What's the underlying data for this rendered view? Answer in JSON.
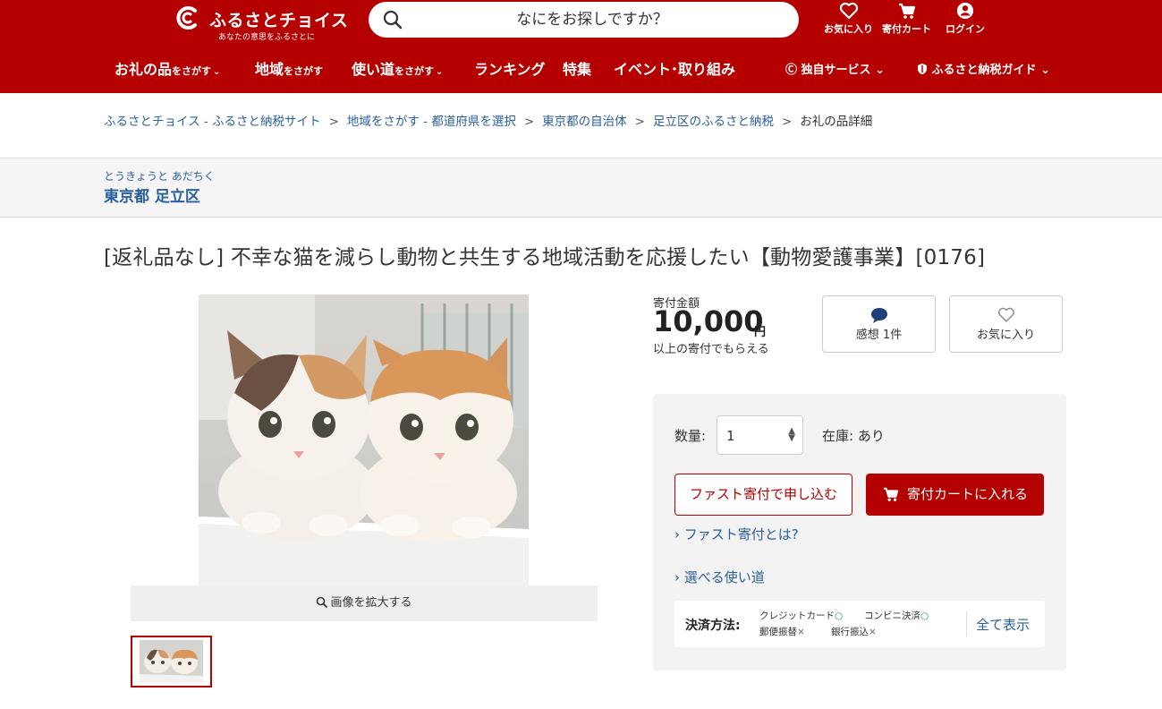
{
  "header": {
    "logo_text": "ふるさとチョイス",
    "logo_sub": "あなたの意思をふるさとに",
    "search_placeholder": "なにをお探しですか？",
    "favorites_label": "お気に入り",
    "cart_label": "寄付カート",
    "login_label": "ログイン",
    "brand_color": "#b50000"
  },
  "nav": {
    "gifts_main": "お礼の品",
    "gifts_small": "をさがす",
    "region_main": "地域",
    "region_small": "をさがす",
    "usage_main": "使い道",
    "usage_small": "をさがす",
    "ranking": "ランキング",
    "feature": "特集",
    "events": "イベント･取り組み",
    "services": "独自サービス",
    "guide": "ふるさと納税ガイド"
  },
  "breadcrumb": {
    "items": [
      "ふるさとチョイス - ふるさと納税サイト",
      "地域をさがす - 都道府県を選択",
      "東京都の自治体",
      "足立区のふるさと納税"
    ],
    "current": "お礼の品詳細",
    "separator": ">"
  },
  "municipality": {
    "ruby": "とうきょうと あだちく",
    "name": "東京都 足立区"
  },
  "product": {
    "title": "[返礼品なし] 不幸な猫を減らし動物と共生する地域活動を応援したい【動物愛護事業】[0176]",
    "zoom_label": "画像を拡大する",
    "image_icon": "kittens-photo"
  },
  "price": {
    "label": "寄付金額",
    "amount": "10,000",
    "unit": "円",
    "note": "以上の寄付でもらえる"
  },
  "actions": {
    "reviews_label": "感想 1件",
    "favorite_label": "お気に入り"
  },
  "order": {
    "quantity_label": "数量:",
    "quantity_value": "1",
    "stock_text": "在庫: あり",
    "fast_button": "ファスト寄付で申し込む",
    "cart_button": "寄付カートに入れる",
    "fast_link": "ファスト寄付とは?",
    "usage_link": "選べる使い道"
  },
  "payment": {
    "label": "決済方法:",
    "methods": [
      {
        "name": "クレジットカード",
        "mark": "○"
      },
      {
        "name": "コンビニ決済",
        "mark": "○"
      },
      {
        "name": "郵便振替",
        "mark": "×"
      },
      {
        "name": "銀行振込",
        "mark": "×"
      }
    ],
    "show_all": "全て表示",
    "ok_color": "#1e9e3c"
  }
}
